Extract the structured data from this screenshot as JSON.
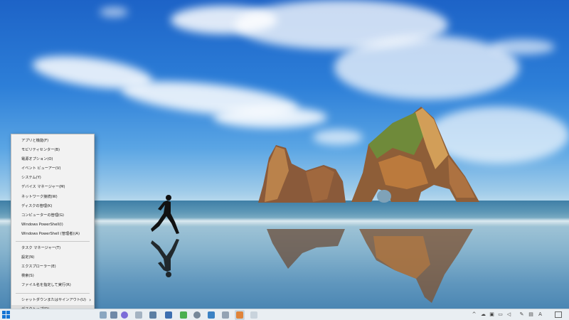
{
  "menu": {
    "items": [
      {
        "label": "アプリと機能(F)"
      },
      {
        "label": "モビリティセンター(B)"
      },
      {
        "label": "電源オプション(O)"
      },
      {
        "label": "イベント ビューアー(V)"
      },
      {
        "label": "システム(Y)"
      },
      {
        "label": "デバイス マネージャー(M)"
      },
      {
        "label": "ネットワーク接続(W)"
      },
      {
        "label": "ディスクの管理(K)"
      },
      {
        "label": "コンピューターの管理(G)"
      },
      {
        "label": "Windows PowerShell(I)"
      },
      {
        "label": "Windows PowerShell (管理者)(A)"
      },
      {
        "label": "タスク マネージャー(T)"
      },
      {
        "label": "設定(N)"
      },
      {
        "label": "エクスプローラー(E)"
      },
      {
        "label": "検索(S)"
      },
      {
        "label": "ファイル名を指定して実行(R)"
      },
      {
        "label": "シャットダウンまたはサインアウト(U)"
      },
      {
        "label": "デスクトップ(D)"
      }
    ]
  },
  "icons": {
    "start": "windows-start-icon",
    "tray": [
      "chevron-up-icon",
      "onedrive-icon",
      "printer-icon",
      "network-icon",
      "volume-icon",
      "pen-icon",
      "keyboard-icon",
      "ime-icon"
    ],
    "notifications": "notification-icon"
  },
  "colors": {
    "menu_bg": "#f2f2f2",
    "menu_highlight": "#dcdcdc",
    "taskbar_bg": "#e9eef2",
    "accent": "#1474d4"
  }
}
